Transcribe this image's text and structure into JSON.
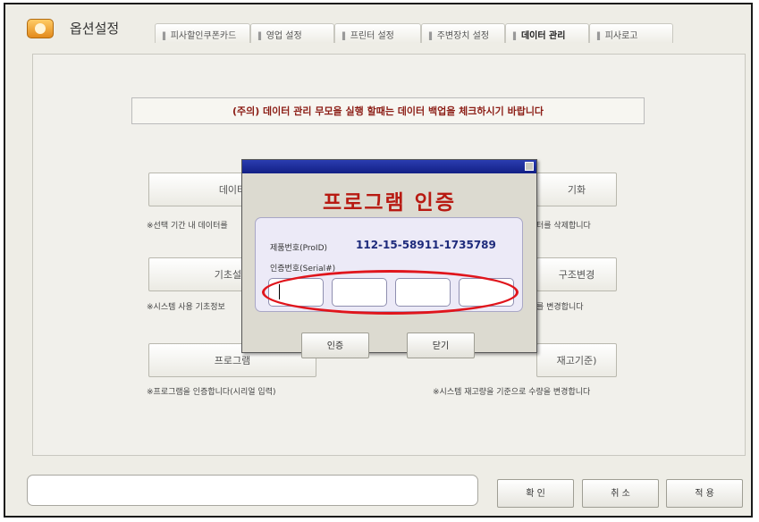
{
  "window": {
    "title": "옵션설정",
    "app_icon": "options-app-icon"
  },
  "tabs": [
    {
      "label": "피사할인쿠폰카드",
      "active": false
    },
    {
      "label": "영업 설정",
      "active": false
    },
    {
      "label": "프린터 설정",
      "active": false
    },
    {
      "label": "주변장치 설정",
      "active": false
    },
    {
      "label": "데이터 관리",
      "active": true
    },
    {
      "label": "피사로고",
      "active": false
    }
  ],
  "main": {
    "warning": "(주의) 데이터 관리 무모을 실행 할때는 데이터 백업을 체크하시기 바랍니다",
    "buttons": [
      {
        "label": "데이터",
        "note": "※선택 기간 내 데이터를"
      },
      {
        "label": "기화",
        "note": "터를 삭제합니다"
      },
      {
        "label": "기초설정",
        "note": "※시스템 사용 기초정보"
      },
      {
        "label": "구조변경",
        "note": "를 변경합니다"
      },
      {
        "label": "프로그램",
        "note": "※프로그램을 인증합니다(시리얼 입력)"
      },
      {
        "label": "재고기준)",
        "note": "※시스템 재고량을 기준으로 수량을 변경합니다"
      }
    ]
  },
  "dialog": {
    "heading": "프로그램 인증",
    "product_label": "제품번호(ProID)",
    "product_value": "112-15-58911-1735789",
    "serial_label": "인증번호(Serial#)",
    "serial_values": [
      "",
      "",
      "",
      ""
    ],
    "confirm_label": "인증",
    "close_label": "닫기",
    "close_icon": "window-close-icon",
    "highlight_color": "#e0151c"
  },
  "footer": {
    "status_text": "",
    "ok_label": "확 인",
    "cancel_label": "취 소",
    "apply_label": "적 용"
  },
  "colors": {
    "warning_text": "#8c1e16",
    "dialog_heading": "#b81a12",
    "dialog_titlebar": "#1e2b9e"
  }
}
